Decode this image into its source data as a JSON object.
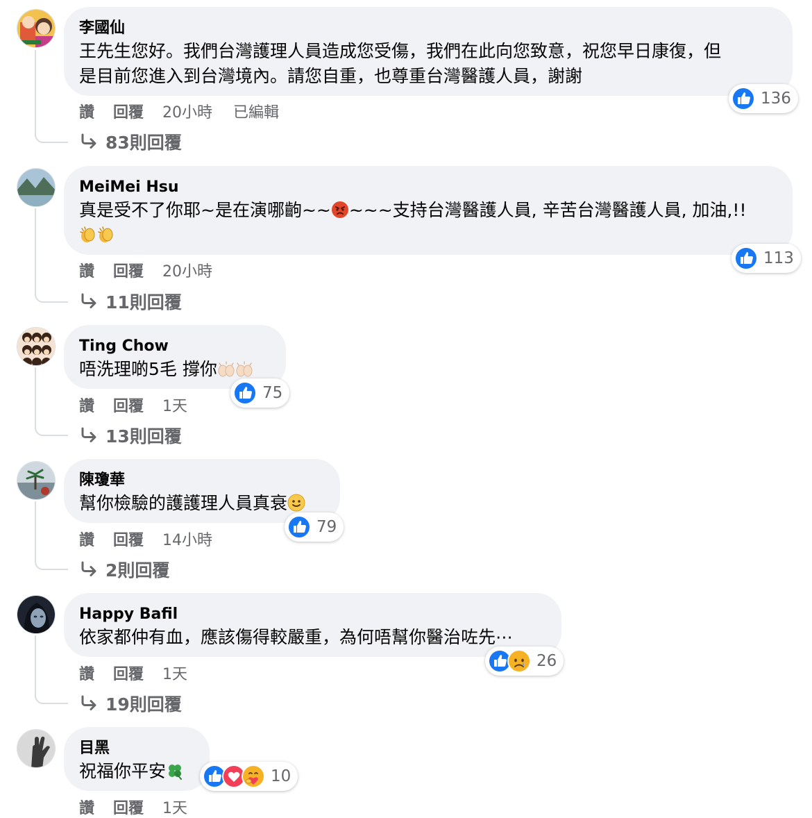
{
  "comments": [
    {
      "author": "李國仙",
      "lines": [
        "王先生您好。我們台灣護理人員造成您受傷，我們在此向您致意，祝您早日康復，但",
        "是目前您進入到台灣境內。請您自重，也尊重台灣醫護人員，謝謝"
      ],
      "reaction_count": "136",
      "like": "讚",
      "reply": "回覆",
      "time": "20小時",
      "edited": "已編輯",
      "replies": "83則回覆"
    },
    {
      "author": "MeiMei Hsu",
      "text_a": "真是受不了你耶~是在演哪齣~~",
      "text_b": "~~~支持台灣醫護人員, 辛苦台灣醫護人員, 加油,!!",
      "reaction_count": "113",
      "like": "讚",
      "reply": "回覆",
      "time": "20小時",
      "replies": "11則回覆"
    },
    {
      "author": "Ting Chow",
      "text": "唔洗理啲5毛 撐你",
      "reaction_count": "75",
      "like": "讚",
      "reply": "回覆",
      "time": "1天",
      "replies": "13則回覆"
    },
    {
      "author": "陳瓊華",
      "text": "幫你檢驗的護護理人員真衰",
      "reaction_count": "79",
      "like": "讚",
      "reply": "回覆",
      "time": "14小時",
      "replies": "2則回覆"
    },
    {
      "author": "Happy Bafil",
      "text": "依家都仲有血，應該傷得較嚴重，為何唔幫你醫治咗先⋯",
      "reaction_count": "26",
      "like": "讚",
      "reply": "回覆",
      "time": "1天",
      "replies": "19則回覆"
    },
    {
      "author": "目黑",
      "text": "祝福你平安",
      "reaction_count": "10",
      "like": "讚",
      "reply": "回覆",
      "time": "1天"
    }
  ],
  "icons": {
    "like": "thumbs-up-icon",
    "love": "heart-icon",
    "care": "care-icon",
    "sad": "sad-face-icon",
    "angry": "angry-face-icon",
    "clap": "clapping-hands-icon",
    "raised_hands": "raised-hands-icon",
    "smile": "smile-face-icon",
    "clover": "four-leaf-clover-icon",
    "reply_arrow": "reply-arrow-icon"
  },
  "colors": {
    "like_blue": "#1877f2",
    "love_red": "#f33e58",
    "care_yellow": "#f7b125",
    "bubble_bg": "#f0f2f5",
    "muted_text": "#65676b"
  }
}
